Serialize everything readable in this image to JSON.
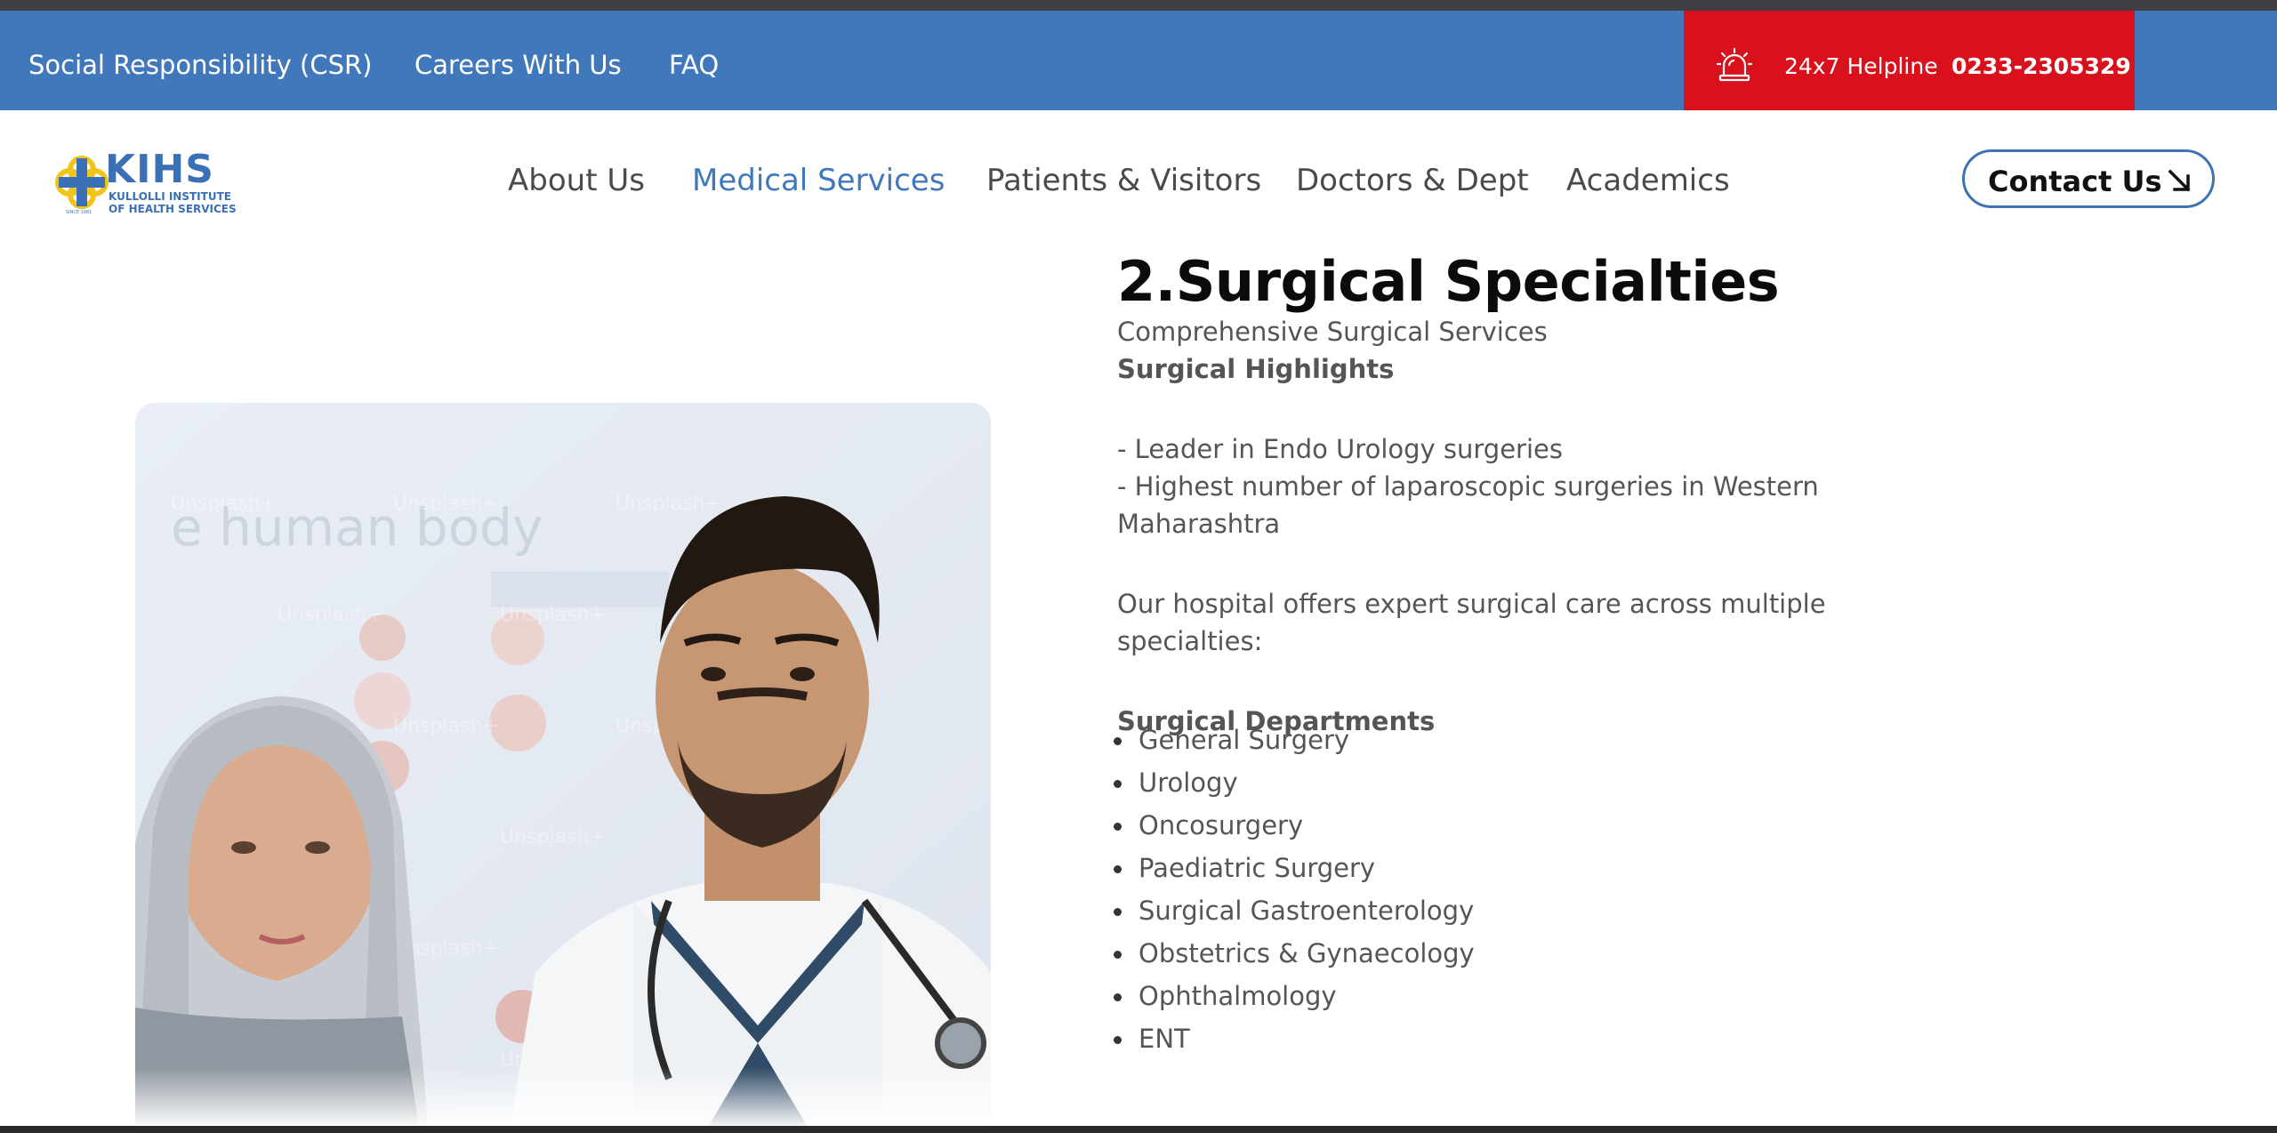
{
  "topbar": {
    "links": [
      "Social Responsibility (CSR)",
      "Careers With Us",
      "FAQ"
    ],
    "helpline_label": "24x7 Helpline",
    "helpline_number": "0233-2305329",
    "helpline_icon": "alarm-bell-icon",
    "bar_color": "#4178bb",
    "helpline_color": "#d9111c"
  },
  "logo": {
    "title": "KIHS",
    "subtitle_line1": "KULLOLLI INSTITUTE",
    "subtitle_line2": "OF HEALTH SERVICES",
    "tiny_text": "SINCE 1981"
  },
  "nav": {
    "items": [
      "About Us",
      "Medical Services",
      "Patients & Visitors",
      "Doctors & Dept",
      "Academics"
    ],
    "active": "Medical Services",
    "contact_label": "Contact Us",
    "contact_icon": "arrow-down-right-icon"
  },
  "photo": {
    "alt": "Two doctors in white coats with stethoscopes",
    "watermark": "Unsplash+",
    "background_text": "e human body"
  },
  "content": {
    "title": "2.Surgical Specialties",
    "subtitle": "Comprehensive Surgical Services",
    "highlights_heading": "Surgical Highlights",
    "highlight_1": "- Leader in Endo Urology surgeries",
    "highlight_2a": "- Highest number of laparoscopic surgeries in Western",
    "highlight_2b": "Maharashtra",
    "intro_a": "Our hospital offers expert surgical care across multiple",
    "intro_b": "specialties:",
    "departments_heading": "Surgical Departments",
    "departments": [
      "General Surgery",
      "Urology",
      "Oncosurgery",
      "Paediatric Surgery",
      "Surgical Gastroenterology",
      "Obstetrics & Gynaecology",
      "Ophthalmology",
      "ENT"
    ]
  }
}
